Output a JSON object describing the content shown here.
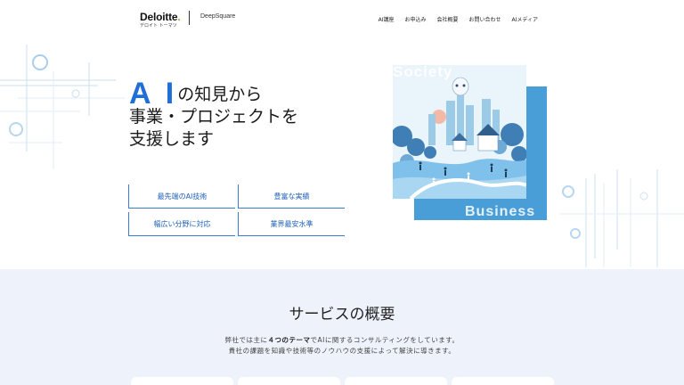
{
  "header": {
    "logo_text": "Deloitte",
    "logo_dot": ".",
    "logo_sub": "デロイト トーマツ",
    "brand": "DeepSquare",
    "nav": [
      "AI講座",
      "お申込み",
      "会社概要",
      "お問い合わせ",
      "AIメディア"
    ]
  },
  "hero": {
    "ai": "A I",
    "line1_rest": "の知見から",
    "line2": "事業・プロジェクトを",
    "line3": "支援します",
    "features": [
      "最先端のAI技術",
      "豊富な実績",
      "幅広い分野に対応",
      "業界最安水準"
    ],
    "image_label_top": "Society",
    "image_label_bottom": "Business"
  },
  "services": {
    "title": "サービスの概要",
    "desc_line1_a": "弊社では主に",
    "desc_line1_b": "４つのテーマ",
    "desc_line1_c": "でAIに関するコンサルティングをしています。",
    "desc_line2": "貴社の課題を知識や技術等のノウハウの支援によって解決に導きます。"
  },
  "colors": {
    "accent": "#1f6fd6",
    "feature_border": "#3a7bd5",
    "services_bg": "#eef3fb",
    "illustration_back": "#4a9ed8"
  }
}
